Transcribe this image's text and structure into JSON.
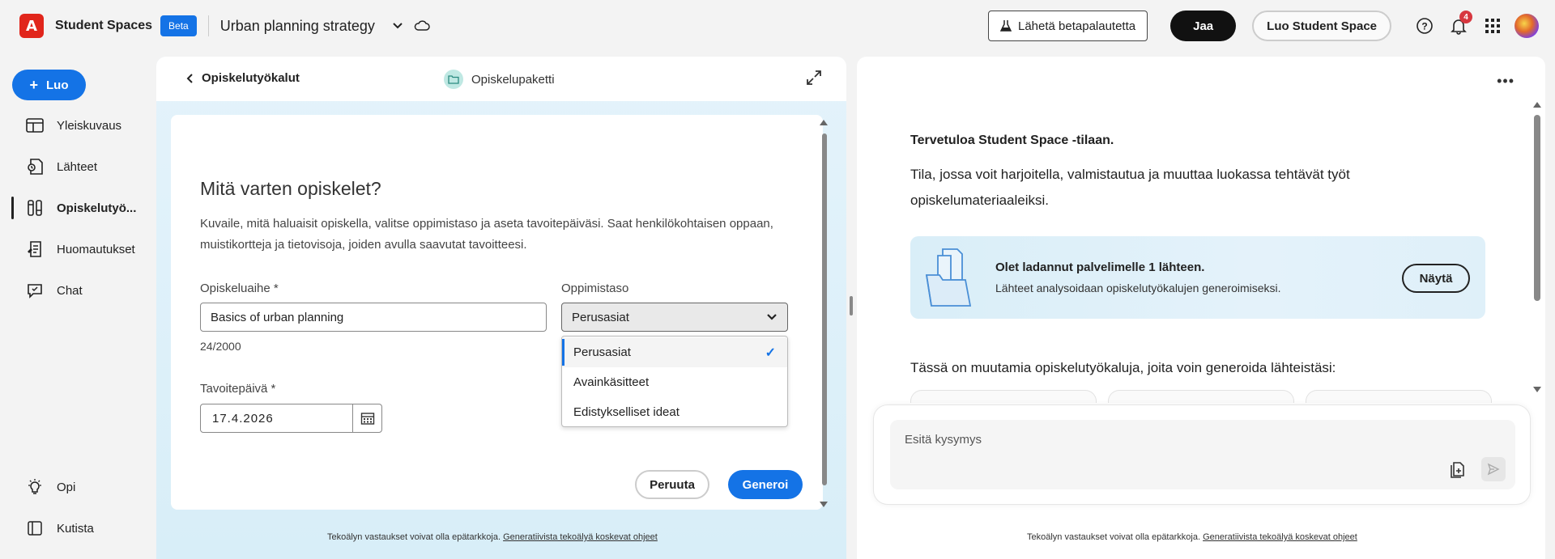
{
  "topbar": {
    "brand_logo_glyph": "A",
    "brand_name": "Student Spaces",
    "beta": "Beta",
    "doc_title": "Urban planning strategy",
    "feedback_btn": "Lähetä betapalautetta",
    "share_btn": "Jaa",
    "create_space_btn": "Luo Student Space",
    "notification_count": "4"
  },
  "sidebar": {
    "create_label": "Luo",
    "items": [
      {
        "label": "Yleiskuvaus",
        "icon": "layout-icon"
      },
      {
        "label": "Lähteet",
        "icon": "sources-icon"
      },
      {
        "label": "Opiskelutyö...",
        "icon": "study-tools-icon"
      },
      {
        "label": "Huomautukset",
        "icon": "notes-icon"
      },
      {
        "label": "Chat",
        "icon": "chat-icon"
      }
    ],
    "bottom_items": [
      {
        "label": "Opi",
        "icon": "lightbulb-icon"
      },
      {
        "label": "Kutista",
        "icon": "collapse-icon"
      }
    ]
  },
  "left_panel": {
    "back_label": "Opiskelutyökalut",
    "tab_label": "Opiskelupaketti",
    "form": {
      "title": "Mitä varten opiskelet?",
      "description": "Kuvaile, mitä haluaisit opiskella, valitse oppimistaso ja aseta tavoitepäiväsi. Saat henkilökohtaisen oppaan, muistikortteja ja tietovisoja, joiden avulla saavutat tavoitteesi.",
      "topic_label": "Opiskeluaihe *",
      "topic_value": "Basics of urban planning",
      "counter": "24/2000",
      "level_label": "Oppimistaso",
      "level_value": "Perusasiat",
      "level_options": [
        "Perusasiat",
        "Avainkäsitteet",
        "Edistykselliset ideat"
      ],
      "date_label": "Tavoitepäivä *",
      "date_value": "17.4.2026",
      "cancel": "Peruuta",
      "generate": "Generoi"
    },
    "footer_text": "Tekoälyn vastaukset voivat olla epätarkkoja.",
    "footer_link": "Generatiivista tekoälyä koskevat ohjeet"
  },
  "right_panel": {
    "welcome_title": "Tervetuloa Student Space -tilaan.",
    "welcome_text": "Tila, jossa voit harjoitella, valmistautua ja muuttaa luokassa tehtävät työt opiskelumateriaaleiksi.",
    "source_title": "Olet ladannut palvelimelle 1 lähteen.",
    "source_sub": "Lähteet analysoidaan opiskelutyökalujen generoimiseksi.",
    "show_btn": "Näytä",
    "tools_intro": "Tässä on muutamia opiskelutyökaluja, joita voin generoida lähteistäsi:",
    "chat_placeholder": "Esitä kysymys",
    "footer_text": "Tekoälyn vastaukset voivat olla epätarkkoja.",
    "footer_link": "Generatiivista tekoälyä koskevat ohjeet"
  },
  "colors": {
    "accent": "#1473e6",
    "brand": "#e1251b",
    "notification": "#d7373f"
  }
}
